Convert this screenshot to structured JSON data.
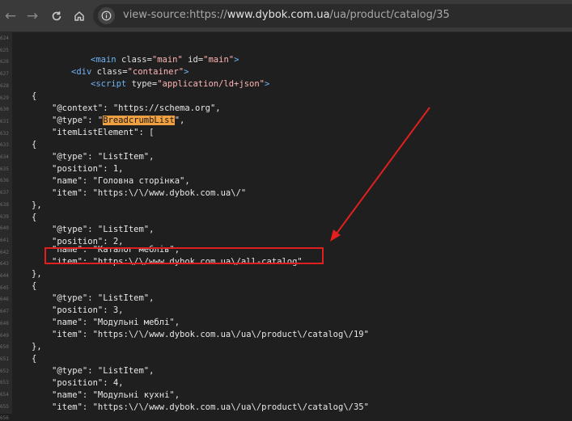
{
  "browser": {
    "url_prefix": "view-source:https://",
    "url_domain": "www.dybok.com.ua",
    "url_path": "/ua/product/catalog/35"
  },
  "line_numbers": [
    "624",
    "625",
    "626",
    "627",
    "628",
    "629",
    "630",
    "631",
    "632",
    "633",
    "634",
    "635",
    "636",
    "637",
    "638",
    "639",
    "640",
    "641",
    "642",
    "643",
    "644",
    "645",
    "646",
    "647",
    "648",
    "649",
    "650",
    "651",
    "652",
    "653",
    "654",
    "655",
    "656"
  ],
  "html_lines": {
    "main_tag": "main",
    "main_attr_class": "class",
    "main_class_val": "main",
    "main_attr_id": "id",
    "main_id_val": "main",
    "div_tag": "div",
    "div_attr_class": "class",
    "div_class_val": "container",
    "script_tag": "script",
    "script_attr_type": "type",
    "script_type_val": "application/ld+json"
  },
  "json": {
    "open_brace": "{",
    "context_line": "\"@context\": \"https://schema.org\",",
    "type_key": "\"@type\": \"",
    "type_value": "BreadcrumbList",
    "type_tail": "\",",
    "item_list_line": "\"itemListElement\": [",
    "items": [
      {
        "open": "{",
        "type": "\"@type\": \"ListItem\",",
        "position": "\"position\": 1,",
        "name": "\"name\": \"Головна сторінка\",",
        "item": "\"item\": \"https:\\/\\/www.dybok.com.ua\\/\"",
        "close": "},"
      },
      {
        "open": "{",
        "type": "\"@type\": \"ListItem\",",
        "position": "\"position\": 2,",
        "name": "\"name\": \"Каталог меблів\",",
        "item": "\"item\": \"https:\\/\\/www.dybok.com.ua\\/all-catalog\"",
        "close": "},"
      },
      {
        "open": "{",
        "type": "\"@type\": \"ListItem\",",
        "position": "\"position\": 3,",
        "name": "\"name\": \"Модульні меблі\",",
        "item": "\"item\": \"https:\\/\\/www.dybok.com.ua\\/ua\\/product\\/catalog\\/19\"",
        "close": "},"
      },
      {
        "open": "{",
        "type": "\"@type\": \"ListItem\",",
        "position": "\"position\": 4,",
        "name": "\"name\": \"Модульні кухні\",",
        "item": "\"item\": \"https:\\/\\/www.dybok.com.ua\\/ua\\/product\\/catalog\\/35\"",
        "close": "}"
      }
    ]
  },
  "annotation": {
    "arrow_color": "#e21f1f",
    "box_color": "#e21f1f"
  }
}
